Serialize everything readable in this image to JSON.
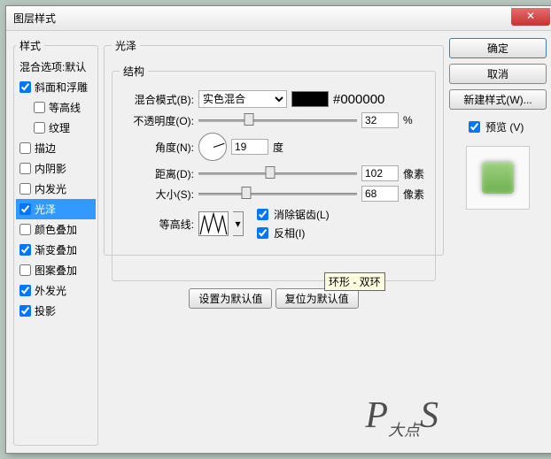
{
  "window": {
    "title": "图层样式"
  },
  "left": {
    "header": "样式",
    "items": [
      {
        "label": "混合选项:默认",
        "checked": null
      },
      {
        "label": "斜面和浮雕",
        "checked": true
      },
      {
        "label": "等高线",
        "checked": false,
        "indent": true
      },
      {
        "label": "纹理",
        "checked": false,
        "indent": true
      },
      {
        "label": "描边",
        "checked": false
      },
      {
        "label": "内阴影",
        "checked": false
      },
      {
        "label": "内发光",
        "checked": false
      },
      {
        "label": "光泽",
        "checked": true,
        "selected": true
      },
      {
        "label": "颜色叠加",
        "checked": false
      },
      {
        "label": "渐变叠加",
        "checked": true
      },
      {
        "label": "图案叠加",
        "checked": false
      },
      {
        "label": "外发光",
        "checked": true
      },
      {
        "label": "投影",
        "checked": true
      }
    ]
  },
  "center": {
    "group_title": "光泽",
    "structure_title": "结构",
    "blend_mode_label": "混合模式(B):",
    "blend_mode_value": "实色混合",
    "color_hex": "#000000",
    "opacity_label": "不透明度(O):",
    "opacity_value": "32",
    "opacity_unit": "%",
    "angle_label": "角度(N):",
    "angle_value": "19",
    "angle_unit": "度",
    "distance_label": "距离(D):",
    "distance_value": "102",
    "distance_unit": "像素",
    "size_label": "大小(S):",
    "size_value": "68",
    "size_unit": "像素",
    "contour_label": "等高线:",
    "antialias_label": "消除锯齿(L)",
    "invert_label": "反相(I)",
    "default_btn": "设置为默认值",
    "reset_btn": "复位为默认值",
    "tooltip": "环形 - 双环"
  },
  "right": {
    "ok": "确定",
    "cancel": "取消",
    "new_style": "新建样式(W)...",
    "preview_label": "预览 (V)"
  }
}
